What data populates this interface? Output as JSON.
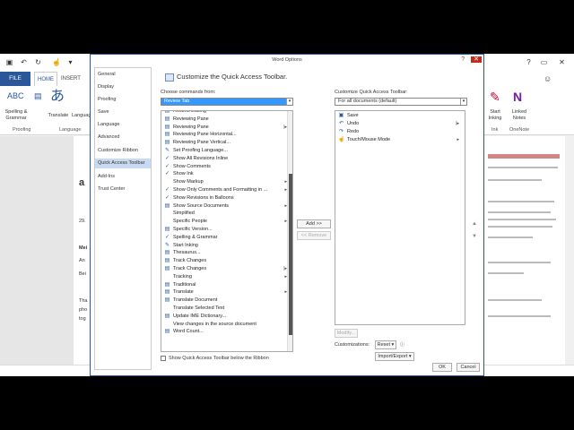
{
  "word": {
    "qat_icons": [
      "save-icon",
      "undo-icon",
      "redo-icon",
      "touch-mode-icon",
      "customize-icon"
    ],
    "tabs": [
      "FILE",
      "HOME",
      "INSERT"
    ],
    "ribbon": {
      "spelling_label": "Spelling &",
      "spelling_label2": "Grammar",
      "translate_label": "Translate",
      "language_label": "Language",
      "group_proofing": "Proofing",
      "group_language": "Language",
      "start_inking_label": "Start",
      "start_inking_label2": "Inking",
      "linked_notes_label": "Linked",
      "linked_notes_label2": "Notes",
      "group_ink": "Ink",
      "group_onenote": "OneNote"
    },
    "doc_fragments": [
      "29.",
      "Mei",
      "An",
      "Bei",
      "Tha",
      "pho",
      "tog"
    ]
  },
  "dialog": {
    "title": "Word Options",
    "nav": [
      "General",
      "Display",
      "Proofing",
      "Save",
      "Language",
      "Advanced",
      "Customize Ribbon",
      "Quick Access Toolbar",
      "Add-Ins",
      "Trust Center"
    ],
    "nav_active_index": 7,
    "header": "Customize the Quick Access Toolbar.",
    "choose_label": "Choose commands from:",
    "choose_value": "Review Tab",
    "customize_label": "Customize Quick Access Toolbar:",
    "customize_value": "For all documents (default)",
    "commands": [
      {
        "label": "Restrict Editing",
        "icon": "▤",
        "sub": ""
      },
      {
        "label": "Reviewing Pane",
        "icon": "▤",
        "sub": ""
      },
      {
        "label": "Reviewing Pane",
        "icon": "▤",
        "sub": "|▸"
      },
      {
        "label": "Reviewing Pane Horizontal...",
        "icon": "▤",
        "sub": ""
      },
      {
        "label": "Reviewing Pane Vertical...",
        "icon": "▤",
        "sub": ""
      },
      {
        "label": "Set Proofing Language...",
        "icon": "✎",
        "sub": ""
      },
      {
        "label": "Show All Revisions Inline",
        "icon": "✓",
        "sub": ""
      },
      {
        "label": "Show Comments",
        "icon": "✓",
        "sub": ""
      },
      {
        "label": "Show Ink",
        "icon": "✓",
        "sub": ""
      },
      {
        "label": "Show Markup",
        "icon": "",
        "sub": "▸"
      },
      {
        "label": "Show Only Comments and Formatting in ...",
        "icon": "✓",
        "sub": "▸"
      },
      {
        "label": "Show Revisions in Balloons",
        "icon": "✓",
        "sub": ""
      },
      {
        "label": "Show Source Documents",
        "icon": "▤",
        "sub": "▸"
      },
      {
        "label": "Simplified",
        "icon": "",
        "sub": ""
      },
      {
        "label": "Specific People",
        "icon": "",
        "sub": "▸"
      },
      {
        "label": "Specific Version...",
        "icon": "▤",
        "sub": ""
      },
      {
        "label": "Spelling & Grammar",
        "icon": "✓",
        "sub": ""
      },
      {
        "label": "Start Inking",
        "icon": "✎",
        "sub": ""
      },
      {
        "label": "Thesaurus...",
        "icon": "▤",
        "sub": ""
      },
      {
        "label": "Track Changes",
        "icon": "▤",
        "sub": ""
      },
      {
        "label": "Track Changes",
        "icon": "▤",
        "sub": "|▸"
      },
      {
        "label": "Tracking",
        "icon": "",
        "sub": "▸"
      },
      {
        "label": "Traditional",
        "icon": "▤",
        "sub": ""
      },
      {
        "label": "Translate",
        "icon": "▤",
        "sub": "▸"
      },
      {
        "label": "Translate Document",
        "icon": "▤",
        "sub": ""
      },
      {
        "label": "Translate Selected Text",
        "icon": "",
        "sub": ""
      },
      {
        "label": "Update IME Dictionary...",
        "icon": "▤",
        "sub": ""
      },
      {
        "label": "View changes in the source document",
        "icon": "",
        "sub": ""
      },
      {
        "label": "Word Count...",
        "icon": "▤",
        "sub": ""
      }
    ],
    "qat_items": [
      {
        "label": "Save",
        "icon": "▣",
        "sub": ""
      },
      {
        "label": "Undo",
        "icon": "↶",
        "sub": "|▸"
      },
      {
        "label": "Redo",
        "icon": "↷",
        "sub": ""
      },
      {
        "label": "Touch/Mouse Mode",
        "icon": "☝",
        "sub": "▸"
      }
    ],
    "add_button": "Add >>",
    "remove_button": "<< Remove",
    "modify_button": "Modify...",
    "customizations_label": "Customizations:",
    "reset_button": "Reset ▾",
    "import_export_button": "Import/Export ▾",
    "show_below_label": "Show Quick Access Toolbar below the Ribbon",
    "ok_button": "OK",
    "cancel_button": "Cancel"
  }
}
